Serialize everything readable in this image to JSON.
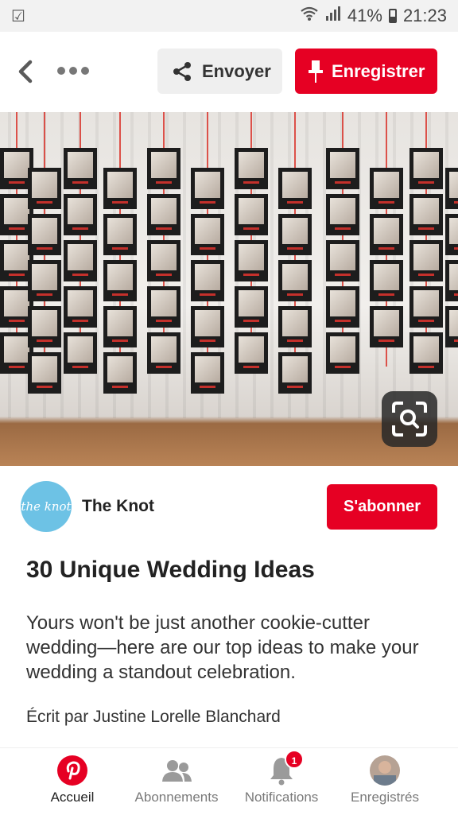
{
  "status_bar": {
    "battery": "41%",
    "time": "21:23"
  },
  "toolbar": {
    "send_label": "Envoyer",
    "save_label": "Enregistrer"
  },
  "author": {
    "name": "The Knot",
    "avatar_text": "the knot",
    "follow_label": "S'abonner"
  },
  "pin": {
    "title": "30 Unique Wedding Ideas",
    "description": "Yours won't be just another cookie-cutter wedding—here are our top ideas to make your wedding a standout celebration.",
    "byline": "Écrit par Justine Lorelle Blanchard"
  },
  "nav": {
    "items": [
      {
        "label": "Accueil",
        "icon": "pinterest-icon"
      },
      {
        "label": "Abonnements",
        "icon": "people-icon"
      },
      {
        "label": "Notifications",
        "icon": "bell-icon",
        "badge": "1"
      },
      {
        "label": "Enregistrés",
        "icon": "profile-avatar-icon"
      }
    ]
  },
  "colors": {
    "brand": "#e60023",
    "avatar_bg": "#6dc2e5"
  },
  "icons": [
    "checkbox-icon",
    "wifi-icon",
    "signal-icon",
    "battery-icon",
    "back-chevron-icon",
    "more-dots-icon",
    "share-icon",
    "pin-icon",
    "visual-search-icon"
  ]
}
